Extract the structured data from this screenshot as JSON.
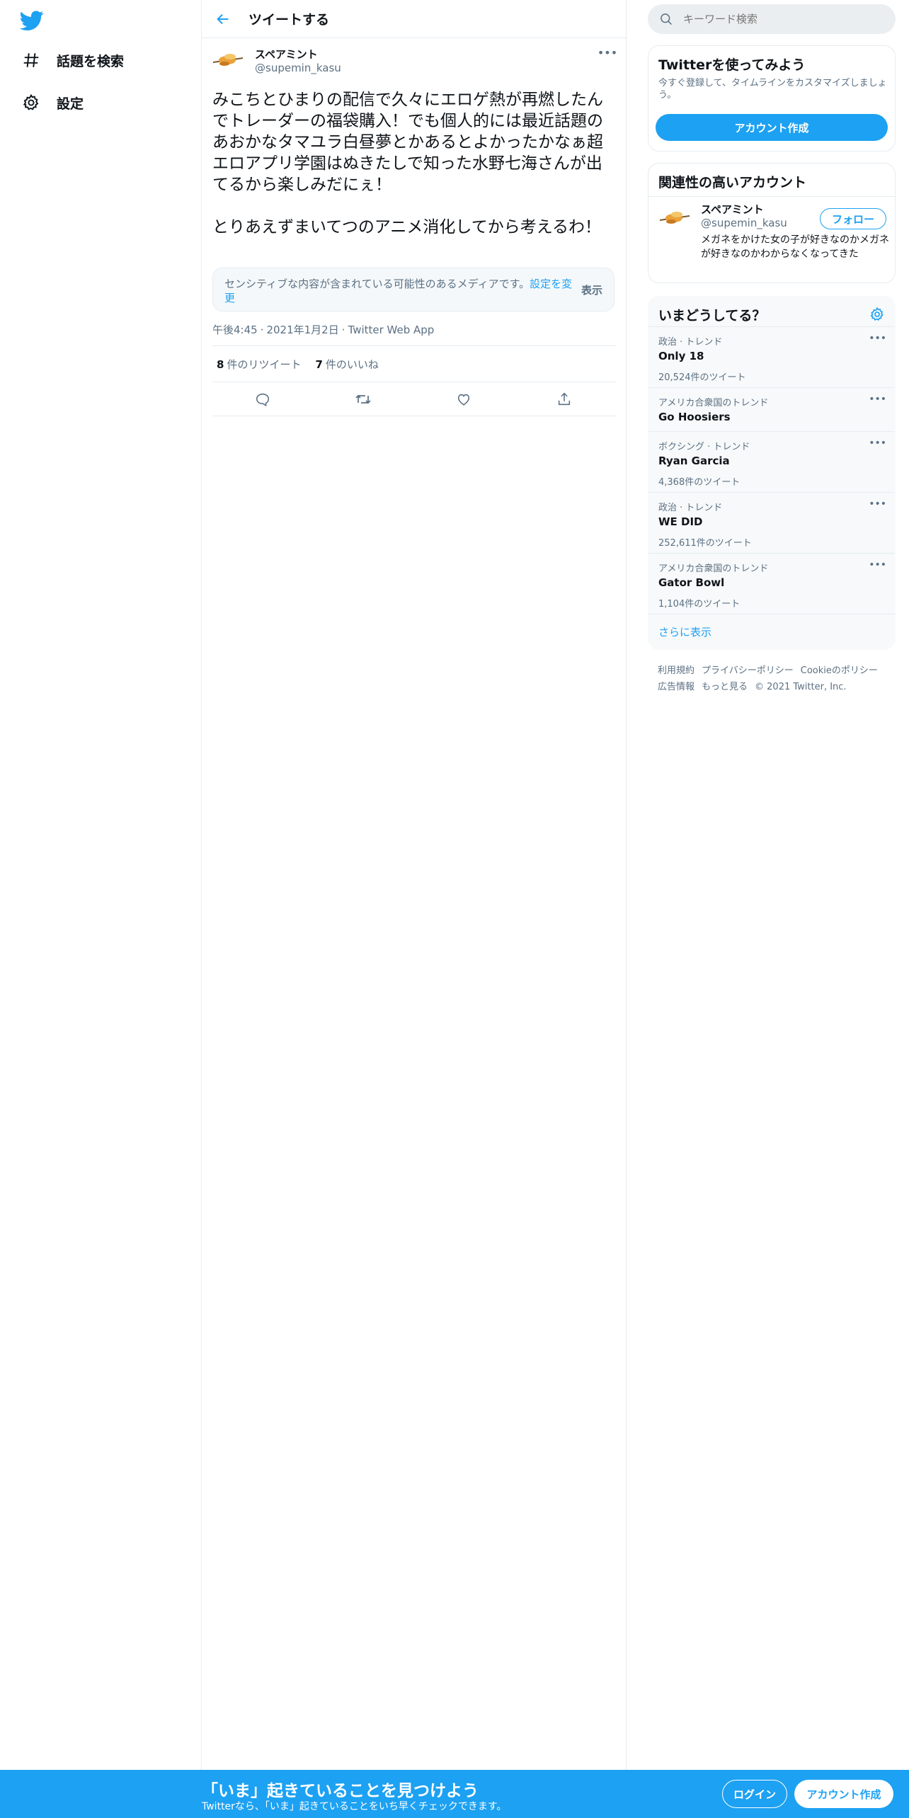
{
  "colors": {
    "accent": "#1da1f2",
    "text_primary": "#0f1419",
    "text_secondary": "#5b7083",
    "border": "#e6ecf0"
  },
  "sidebar": {
    "logo_icon": "twitter-bird-icon",
    "items": [
      {
        "label": "話題を検索",
        "icon": "hashtag-icon"
      },
      {
        "label": "設定",
        "icon": "gear-icon"
      }
    ]
  },
  "header": {
    "back_icon": "back-arrow-icon",
    "title": "ツイートする"
  },
  "tweet": {
    "author_name": "スペアミント",
    "author_handle": "@supemin_kasu",
    "text": "みこちとひまりの配信で久々にエロゲ熱が再燃したんでトレーダーの福袋購入！でも個人的には最近話題のあおかなタマユラ白昼夢とかあるとよかったかなぁ超エロアプリ学園はぬきたしで知った水野七海さんが出てるから楽しみだにぇ！\n\nとりあえずまいてつのアニメ消化してから考えるわ！",
    "sensitive_notice": "センシティブな内容が含まれている可能性のあるメディアです。",
    "sensitive_link": "設定を変更",
    "sensitive_show": "表示",
    "time": "午後4:45",
    "date": "2021年1月2日",
    "source": "Twitter Web App",
    "retweet_count": "8",
    "retweet_label": "件のリツイート",
    "like_count": "7",
    "like_label": "件のいいね"
  },
  "search": {
    "placeholder": "キーワード検索"
  },
  "signup_card": {
    "title": "Twitterを使ってみよう",
    "subtitle": "今すぐ登録して、タイムラインをカスタマイズしましょう。",
    "button": "アカウント作成"
  },
  "related": {
    "title": "関連性の高いアカウント",
    "name": "スペアミント",
    "handle": "@supemin_kasu",
    "bio": "メガネをかけた女の子が好きなのかメガネが好きなのかわからなくなってきた",
    "follow": "フォロー"
  },
  "trends": {
    "title": "いまどうしてる？",
    "items": [
      {
        "context": "政治 · トレンド",
        "name": "Only 18",
        "count": "20,524件のツイート"
      },
      {
        "context": "アメリカ合衆国のトレンド",
        "name": "Go Hoosiers",
        "count": ""
      },
      {
        "context": "ボクシング · トレンド",
        "name": "Ryan Garcia",
        "count": "4,368件のツイート"
      },
      {
        "context": "政治 · トレンド",
        "name": "WE DID",
        "count": "252,611件のツイート"
      },
      {
        "context": "アメリカ合衆国のトレンド",
        "name": "Gator Bowl",
        "count": "1,104件のツイート"
      }
    ],
    "show_more": "さらに表示"
  },
  "footer": {
    "terms": "利用規約",
    "privacy": "プライバシーポリシー",
    "cookie": "Cookieのポリシー",
    "ads": "広告情報",
    "more": "もっと見る",
    "copyright": "© 2021 Twitter, Inc."
  },
  "bottom_bar": {
    "title": "「いま」起きていることを見つけよう",
    "subtitle": "Twitterなら、「いま」起きていることをいち早くチェックできます。",
    "login": "ログイン",
    "signup": "アカウント作成"
  }
}
